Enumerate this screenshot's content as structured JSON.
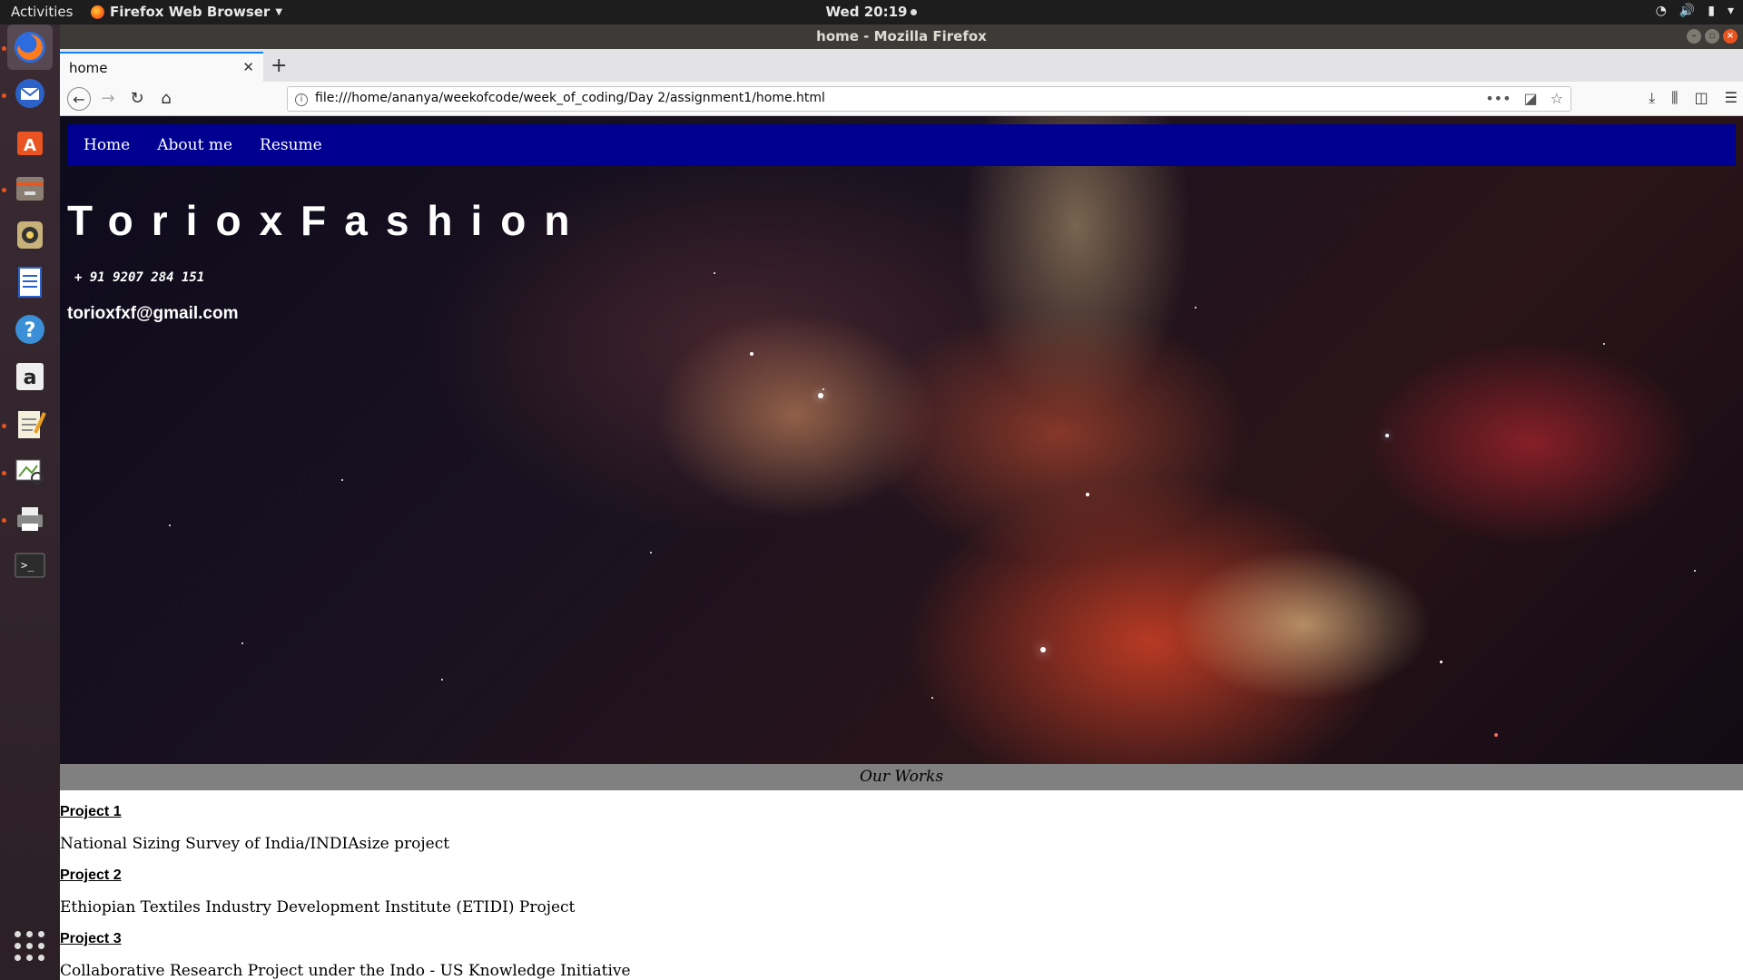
{
  "system_bar": {
    "activities": "Activities",
    "app_name": "Firefox Web Browser",
    "clock": "Wed 20:19"
  },
  "window": {
    "title": "home - Mozilla Firefox"
  },
  "dock": {
    "items": [
      "firefox-icon",
      "thunderbird-icon",
      "software-center-icon",
      "files-icon",
      "rhythmbox-icon",
      "writer-icon",
      "help-icon",
      "amazon-icon",
      "text-editor-icon",
      "image-viewer-icon",
      "printer-icon",
      "terminal-icon"
    ]
  },
  "browser": {
    "tab_title": "home",
    "url": "file:///home/ananya/weekofcode/week_of_coding/Day 2/assignment1/home.html"
  },
  "site": {
    "nav": [
      "Home",
      "About me",
      "Resume"
    ],
    "brand": "TorioxFashion",
    "phone": "+ 91 9207 284 151",
    "email": "torioxfxf@gmail.com",
    "section_title": "Our Works",
    "projects": [
      {
        "title": "Project 1",
        "description": "National Sizing Survey of India/INDIAsize project"
      },
      {
        "title": "Project 2",
        "description": "Ethiopian Textiles Industry Development Institute (ETIDI) Project"
      },
      {
        "title": "Project 3",
        "description": "Collaborative Research Project under the Indo - US Knowledge Initiative"
      }
    ]
  },
  "colors": {
    "nav_bg": "#000090",
    "works_bar_bg": "#808080",
    "ubuntu_orange": "#e95420"
  }
}
